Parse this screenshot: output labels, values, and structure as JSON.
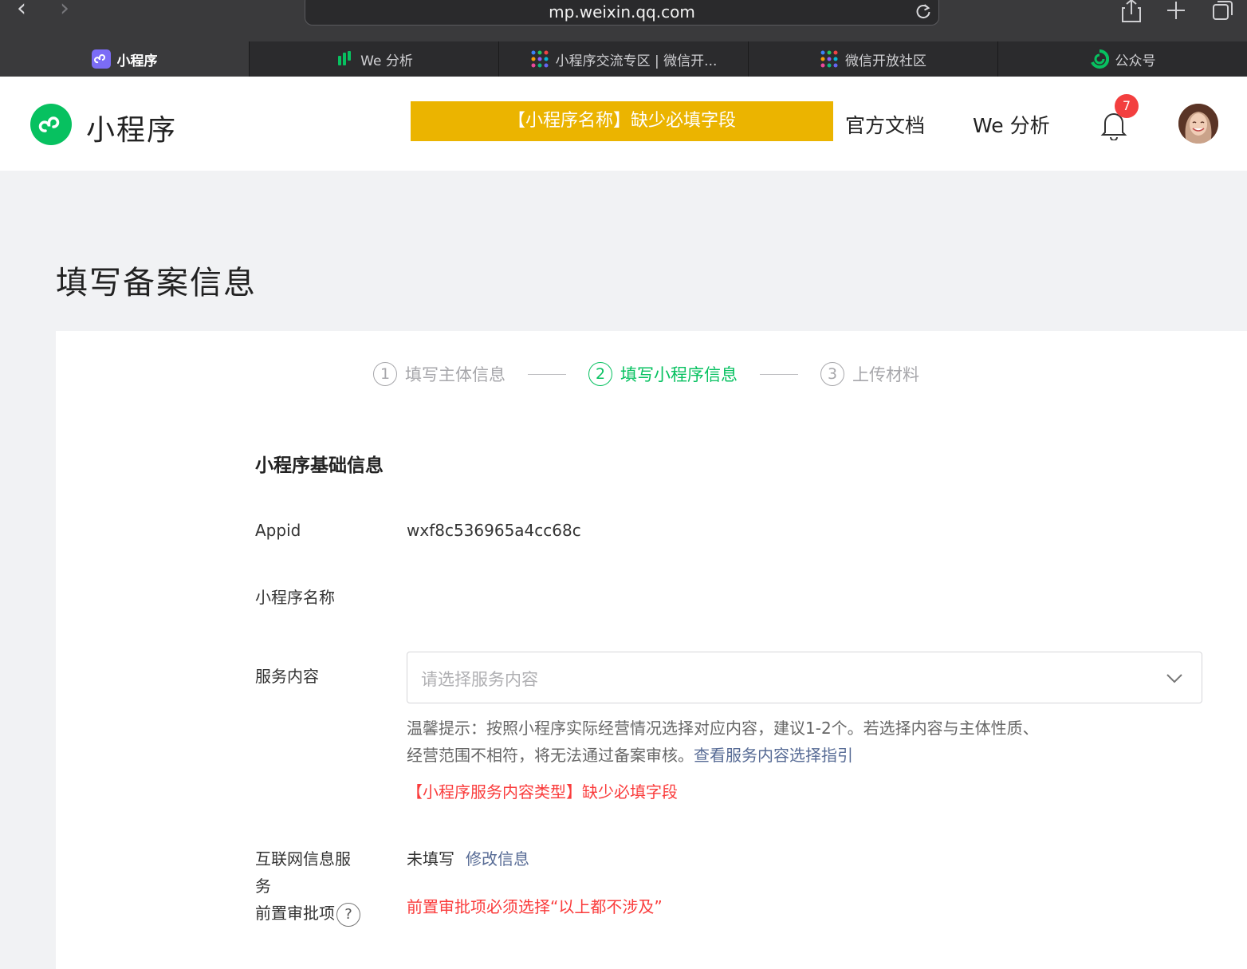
{
  "browser": {
    "url": "mp.weixin.qq.com",
    "tabs": [
      {
        "label": "小程序",
        "icon": "miniprogram-icon"
      },
      {
        "label": "We 分析",
        "icon": "we-analytics-icon"
      },
      {
        "label": "小程序交流专区 | 微信开...",
        "icon": "wechat-dev-icon"
      },
      {
        "label": "微信开放社区",
        "icon": "wechat-dev-icon"
      },
      {
        "label": "公众号",
        "icon": "official-account-icon"
      }
    ]
  },
  "header": {
    "logo_text": "小程序",
    "warning": "【小程序名称】缺少必填字段",
    "links": [
      "官方文档",
      "We 分析"
    ],
    "notification_count": "7"
  },
  "page": {
    "title": "填写备案信息",
    "steps": [
      {
        "num": "1",
        "label": "填写主体信息",
        "active": false
      },
      {
        "num": "2",
        "label": "填写小程序信息",
        "active": true
      },
      {
        "num": "3",
        "label": "上传材料",
        "active": false
      }
    ],
    "section_title": "小程序基础信息",
    "fields": {
      "appid_label": "Appid",
      "appid_value": "wxf8c536965a4cc68c",
      "name_label": "小程序名称",
      "service_label": "服务内容",
      "service_placeholder": "请选择服务内容",
      "tip_text": "温馨提示：按照小程序实际经营情况选择对应内容，建议1-2个。若选择内容与主体性质、经营范围不相符，将无法通过备案审核。",
      "tip_link": "查看服务内容选择指引",
      "service_error": "【小程序服务内容类型】缺少必填字段",
      "internet_label_line1": "互联网信息服",
      "internet_label_line2": "务",
      "internet_label_line3": "前置审批项",
      "internet_status": "未填写",
      "internet_edit": "修改信息",
      "internet_error": "前置审批项必须选择“以上都不涉及”"
    }
  },
  "colors": {
    "brand_green": "#07c160",
    "warning_yellow": "#ebb400",
    "error_red": "#fa3c3c",
    "link_blue": "#576b95"
  }
}
